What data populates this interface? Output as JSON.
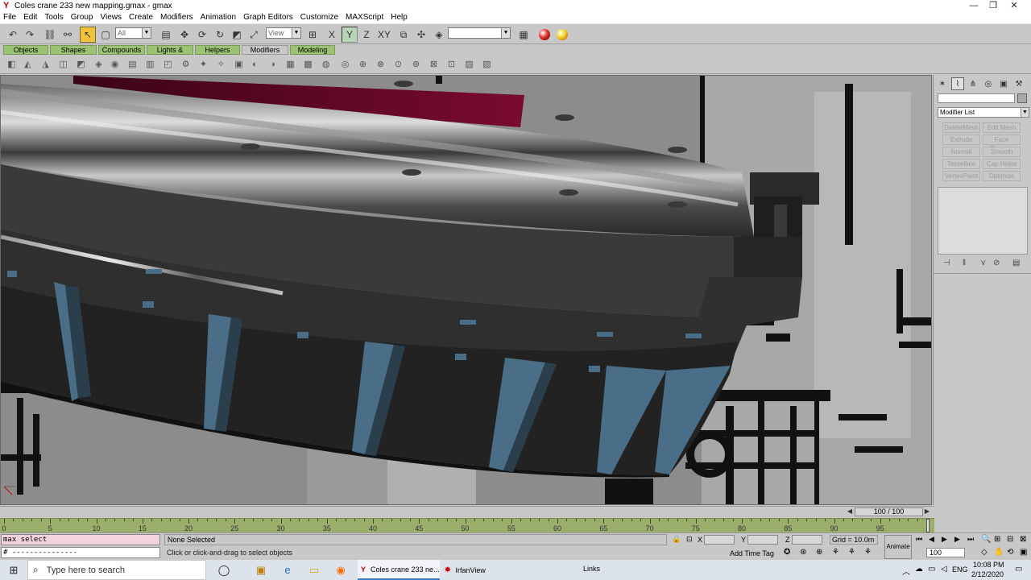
{
  "window": {
    "title": "Coles crane 233 new mapping.gmax - gmax",
    "app_icon": "gmax-icon",
    "controls": {
      "minimize": "—",
      "maximize": "❐",
      "close": "✕"
    }
  },
  "menu": [
    "File",
    "Edit",
    "Tools",
    "Group",
    "Views",
    "Create",
    "Modifiers",
    "Animation",
    "Graph Editors",
    "Customize",
    "MAXScript",
    "Help"
  ],
  "toolbar": {
    "selection_filter": "All",
    "reference_coord": "View",
    "named_selection": ""
  },
  "tabs": [
    "Objects",
    "Shapes",
    "Compounds",
    "Lights & Cameras",
    "Helpers",
    "Modifiers",
    "Modeling"
  ],
  "active_tab": "Modifiers",
  "command_panel": {
    "name_field": "",
    "modifier_list": "Modifier List",
    "modifier_buttons": [
      "DeleteMesh",
      "Edit Mesh",
      "Extrude",
      "Face Extrude",
      "Normal",
      "Smooth",
      "Tessellate",
      "Cap Holes",
      "VertexPaint",
      "Optimize"
    ]
  },
  "timeline": {
    "slider_label": "100 / 100",
    "ticks": [
      0,
      5,
      10,
      15,
      20,
      25,
      30,
      35,
      40,
      45,
      50,
      55,
      60,
      65,
      70,
      75,
      80,
      85,
      90,
      95,
      100
    ],
    "labels": [
      "0",
      "5",
      "10",
      "15",
      "20",
      "25",
      "30",
      "35",
      "40",
      "45",
      "50",
      "55",
      "60",
      "65",
      "70",
      "75",
      "80",
      "85",
      "90",
      "95"
    ]
  },
  "status": {
    "listener_line1": "max select",
    "listener_line2": "# ---------------",
    "selection": "None Selected",
    "prompt": "Click or click-and-drag to select objects",
    "x_label": "X",
    "y_label": "Y",
    "z_label": "Z",
    "grid": "Grid = 10.0m",
    "add_time_tag": "Add Time Tag",
    "animate": "Animate",
    "frame_field": "100"
  },
  "taskbar": {
    "search_placeholder": "Type here to search",
    "apps": [
      {
        "label": "Coles crane 233 ne...",
        "icon": "gmax-icon",
        "active": true
      },
      {
        "label": "IrfanView",
        "icon": "irfanview-icon",
        "active": false
      }
    ],
    "links": "Links",
    "lang": "ENG",
    "time": "10:08 PM",
    "date": "2/12/2020"
  },
  "colors": {
    "track_green": "#9cae6c",
    "tab_green": "#9cc274",
    "active_button": "#f0c23b",
    "viewport_bg": "#8d8d8d",
    "crimson_panel": "#6a0a2a",
    "blue_bracket": "#4a6e88"
  }
}
